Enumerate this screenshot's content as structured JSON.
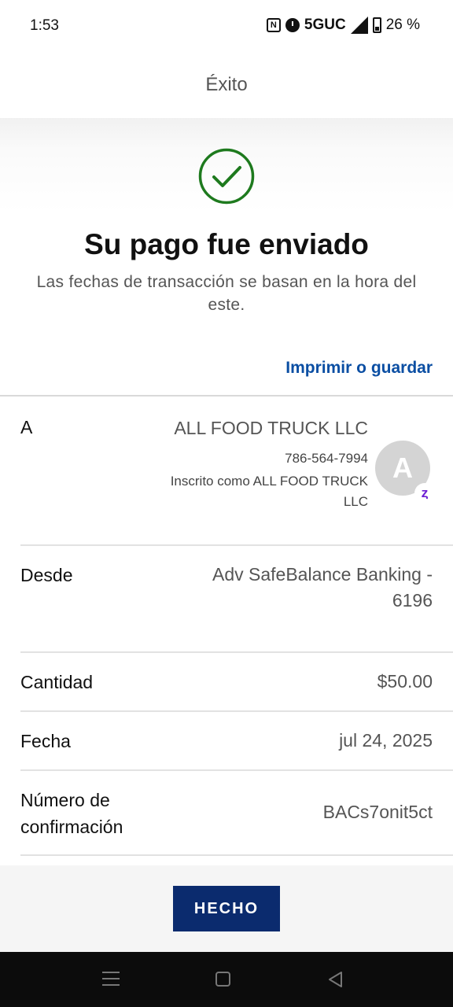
{
  "status_bar": {
    "time": "1:53",
    "network": "5GUC",
    "battery": "26 %"
  },
  "header": {
    "title": "Éxito"
  },
  "success": {
    "title": "Su pago fue enviado",
    "subtitle": "Las fechas de transacción se basan en la hora del este.",
    "print_link": "Imprimir o guardar",
    "icon": "check-circle-icon"
  },
  "details": {
    "to": {
      "label": "A",
      "name": "ALL FOOD TRUCK LLC",
      "phone": "786-564-7994",
      "enrolled": "Inscrito como ALL FOOD TRUCK LLC",
      "avatar_initial": "A",
      "badge": "Z"
    },
    "from": {
      "label": "Desde",
      "value": "Adv SafeBalance Banking - 6196"
    },
    "amount": {
      "label": "Cantidad",
      "value": "$50.00"
    },
    "date": {
      "label": "Fecha",
      "value": "jul 24, 2025"
    },
    "confirmation": {
      "label": "Número de confirmación",
      "value": "BACs7onit5ct"
    }
  },
  "footer": {
    "done_label": "HECHO"
  },
  "colors": {
    "accent": "#0b2b6e",
    "link": "#0a4ea3",
    "success": "#1e7a1e",
    "zelle": "#6d1ed4"
  }
}
